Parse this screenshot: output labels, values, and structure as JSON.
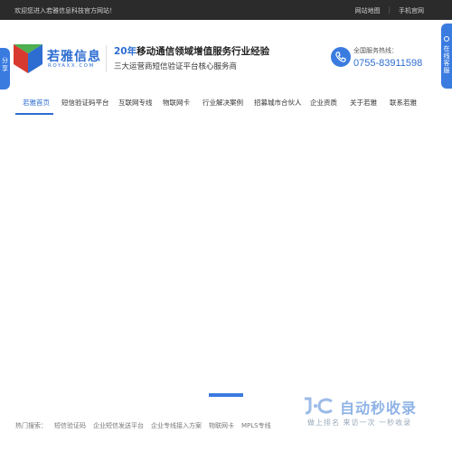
{
  "topbar": {
    "welcome": "欢迎您进入若雅信息科技官方网站！",
    "links": [
      "网站地图",
      "手机官网"
    ]
  },
  "logo": {
    "text": "若雅信息",
    "sub": "ROYAXX.COM"
  },
  "slogan": {
    "num": "20年",
    "rest": "移动通信领域增值服务行业经验",
    "line2": "三大运营商短信验证平台核心服务商"
  },
  "hotline": {
    "label": "全国服务热线：",
    "number": "0755-83911598"
  },
  "nav": {
    "items": [
      "若雅首页",
      "短信验证码平台",
      "互联网专线",
      "物联网卡",
      "行业解决案例",
      "招募城市合伙人",
      "企业资质",
      "关于若雅",
      "联系若雅"
    ],
    "active_index": 0
  },
  "side": {
    "share": "分享",
    "service": "在线客服"
  },
  "footer": {
    "hot_label": "热门搜索：",
    "hot_items": [
      "短信验证码",
      "企业短信发送平台",
      "企业专线接入方案",
      "物联网卡",
      "MPLS专线"
    ]
  },
  "watermark": {
    "title": "自动秒收录",
    "sub": "做上排名 来访一次 一秒收录"
  },
  "colors": {
    "brand": "#2d6dd1",
    "topbar": "#2b2b2b"
  }
}
